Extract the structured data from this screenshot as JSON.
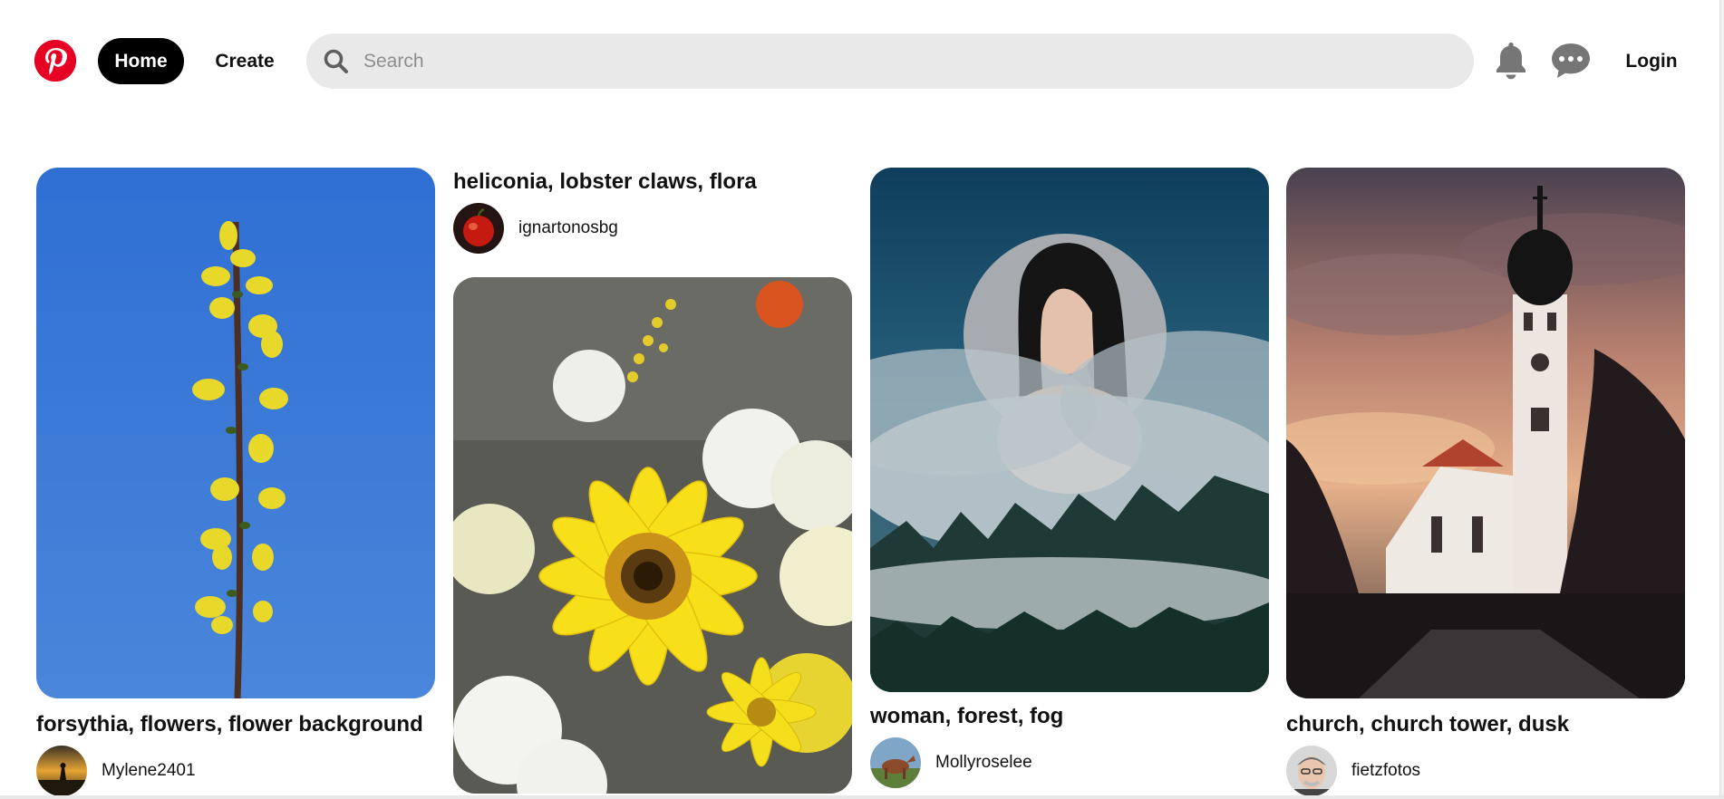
{
  "header": {
    "logo_icon": "pinterest-logo-icon",
    "home_label": "Home",
    "create_label": "Create",
    "search_placeholder": "Search",
    "search_icon": "search-icon",
    "notifications_icon": "bell-icon",
    "messages_icon": "chat-icon",
    "login_label": "Login"
  },
  "colors": {
    "brand": "#e60023",
    "search_bg": "#e9e9e9",
    "active_button_bg": "#000000"
  },
  "pins": [
    {
      "title": "forsythia, flowers, flower background",
      "author": "Mylene2401"
    },
    {
      "title": "heliconia, lobster claws, flora",
      "author": "ignartonosbg"
    },
    {
      "title": "woman, forest, fog",
      "author": "Mollyroselee"
    },
    {
      "title": "church, church tower, dusk",
      "author": "fietzfotos"
    }
  ]
}
